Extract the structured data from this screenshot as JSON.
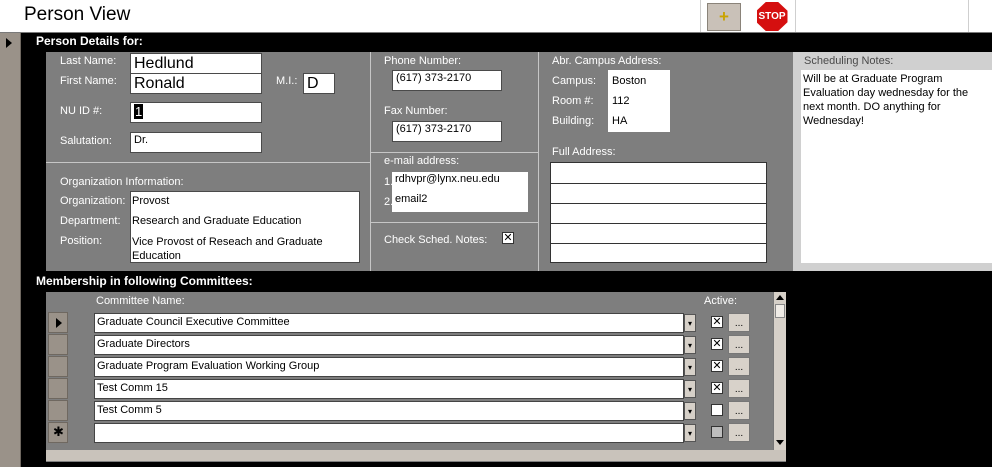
{
  "window": {
    "title": "Person View"
  },
  "toolbar": {
    "add_label": "+",
    "stop_label": "STOP"
  },
  "person_details": {
    "section_label": "Person Details for:",
    "last_name": {
      "label": "Last Name:",
      "value": "Hedlund"
    },
    "first_name": {
      "label": "First Name:",
      "value": "Ronald"
    },
    "mi": {
      "label": "M.I.:",
      "value": "D"
    },
    "nu_id": {
      "label": "NU ID #:",
      "value": "1"
    },
    "salutation": {
      "label": "Salutation:",
      "value": "Dr."
    },
    "org_info_label": "Organization Information:",
    "organization": {
      "label": "Organization:",
      "value": "Provost"
    },
    "department": {
      "label": "Department:",
      "value": "Research and Graduate Education"
    },
    "position": {
      "label": "Position:",
      "value": "Vice Provost of Reseach and Graduate Education"
    },
    "phone": {
      "label": "Phone Number:",
      "value": "(617)   373-2170"
    },
    "fax": {
      "label": "Fax Number:",
      "value": "(617)   373-2170"
    },
    "email": {
      "label": "e-mail address:",
      "entries": [
        {
          "num": "1.",
          "value": "rdhvpr@lynx.neu.edu"
        },
        {
          "num": "2.",
          "value": "email2"
        }
      ]
    },
    "check_sched": {
      "label": "Check Sched. Notes:",
      "checked": true,
      "mark": "✕"
    },
    "campus_address": {
      "label": "Abr. Campus Address:",
      "campus": {
        "label": "Campus:",
        "value": "Boston"
      },
      "room": {
        "label": "Room #:",
        "value": "112"
      },
      "building": {
        "label": "Building:",
        "value": "HA"
      }
    },
    "full_address_label": "Full Address:",
    "scheduling_notes": {
      "label": "Scheduling Notes:",
      "text": "Will be at Graduate Program Evaluation day wednesday for the next month.  DO anything for Wednesday!"
    }
  },
  "committees": {
    "section_label": "Membership in following Committees:",
    "col_name": "Committee Name:",
    "col_active": "Active:",
    "rows": [
      {
        "name": "Graduate Council Executive Committee",
        "active": "✕",
        "current": true
      },
      {
        "name": "Graduate Directors",
        "active": "✕",
        "current": false
      },
      {
        "name": "Graduate Program Evaluation Working Group",
        "active": "✕",
        "current": false
      },
      {
        "name": "Test Comm 15",
        "active": "✕",
        "current": false
      },
      {
        "name": "Test Comm 5",
        "active": "",
        "current": false
      },
      {
        "name": "",
        "active": "",
        "current": false,
        "new_record": true
      }
    ],
    "new_record_marker": "✱",
    "dots_label": "...",
    "combo_arrow": "▾"
  },
  "colors": {
    "panel": "#7e7e7e",
    "background": "#000000",
    "stop": "#d50f0f",
    "record_selector": "#9a9289"
  },
  "icons": [
    "add-icon",
    "stop-icon",
    "record-pointer-icon",
    "dropdown-arrow-icon",
    "new-record-icon"
  ]
}
